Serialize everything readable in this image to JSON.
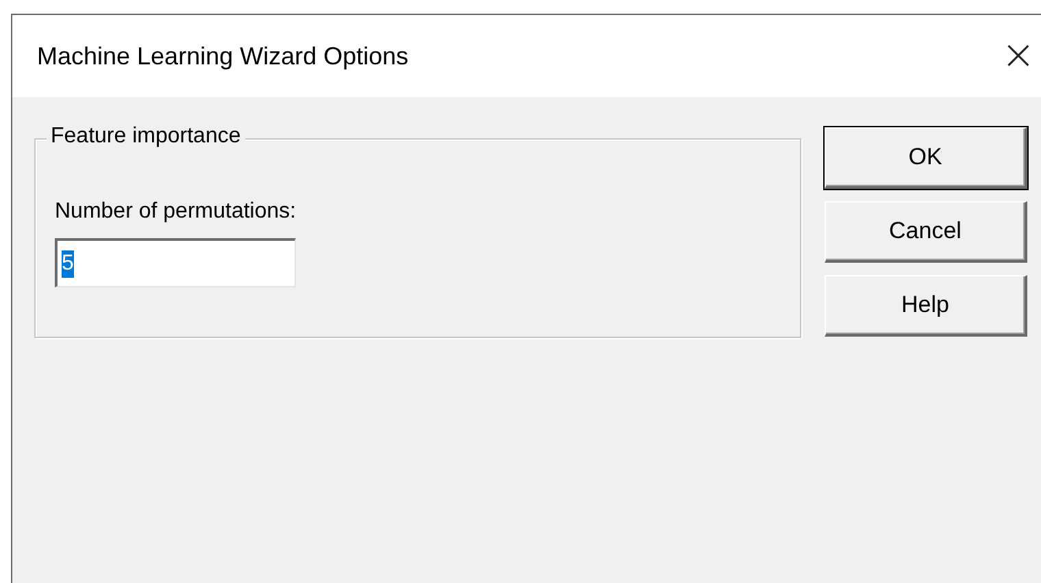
{
  "window": {
    "title": "Machine Learning Wizard Options",
    "close": "×"
  },
  "group": {
    "title": "Feature importance",
    "field_label": "Number of permutations:",
    "field": {
      "value": "5",
      "selected": true
    }
  },
  "buttons": [
    {
      "label": "OK",
      "default": true
    },
    {
      "label": "Cancel",
      "default": false
    },
    {
      "label": "Help",
      "default": false
    }
  ]
}
